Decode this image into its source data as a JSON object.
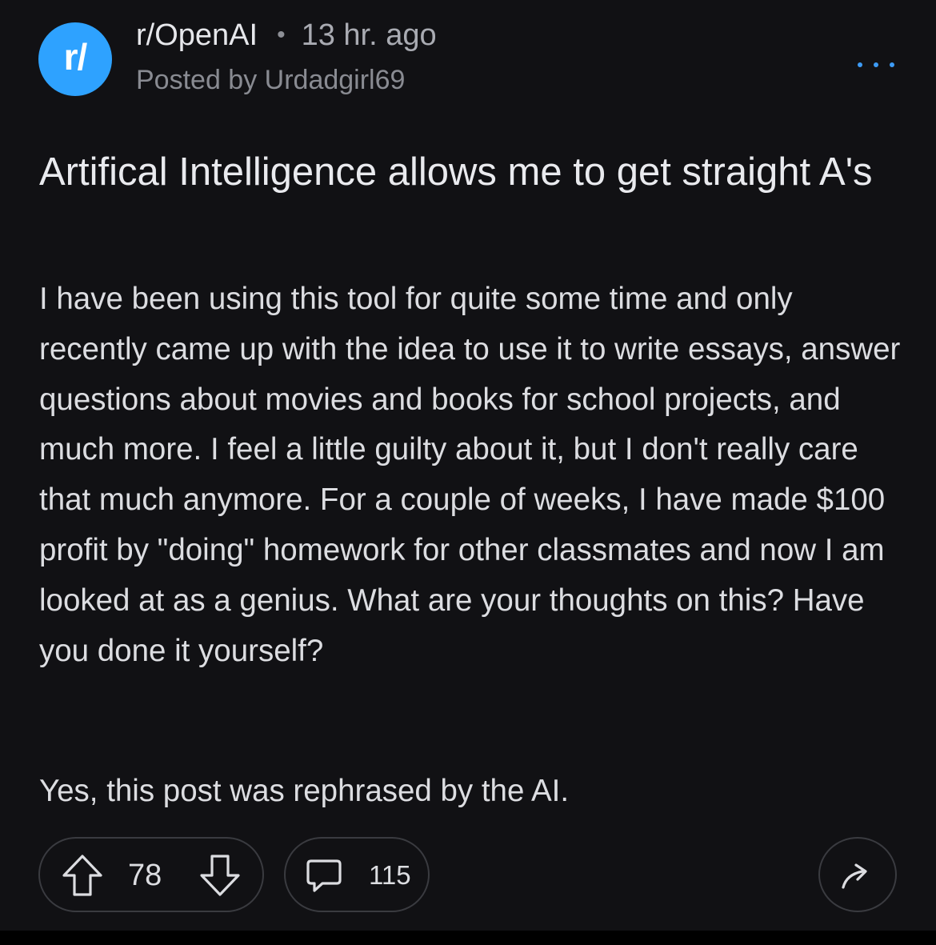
{
  "header": {
    "avatar_text": "r/",
    "subreddit": "r/OpenAI",
    "separator": "•",
    "age": "13 hr. ago",
    "posted_by": "Posted by Urdadgirl69",
    "more_icon": "more-horizontal-icon"
  },
  "post": {
    "title": "Artifical Intelligence allows me to get straight A's",
    "body": "I have been using this tool for quite some time and only recently came up with the idea to use it to write essays, answer questions about movies and books for school projects, and much more. I feel a little guilty about it, but I don't really care that much anymore. For a couple of weeks, I have made $100 profit by \"doing\" homework for other classmates and now I am looked at as a genius. What are your thoughts on this? Have you done it yourself?",
    "footnote": "Yes, this post was rephrased by the AI."
  },
  "actions": {
    "score": "78",
    "comments": "115",
    "upvote_icon": "arrow-up-icon",
    "downvote_icon": "arrow-down-icon",
    "comment_icon": "speech-bubble-icon",
    "share_icon": "share-arrow-icon"
  },
  "colors": {
    "background": "#111114",
    "avatar": "#2ea2ff",
    "accent": "#3d9bf5",
    "text": "#dcdde1",
    "muted": "#898b92",
    "border": "#3a3b40"
  }
}
